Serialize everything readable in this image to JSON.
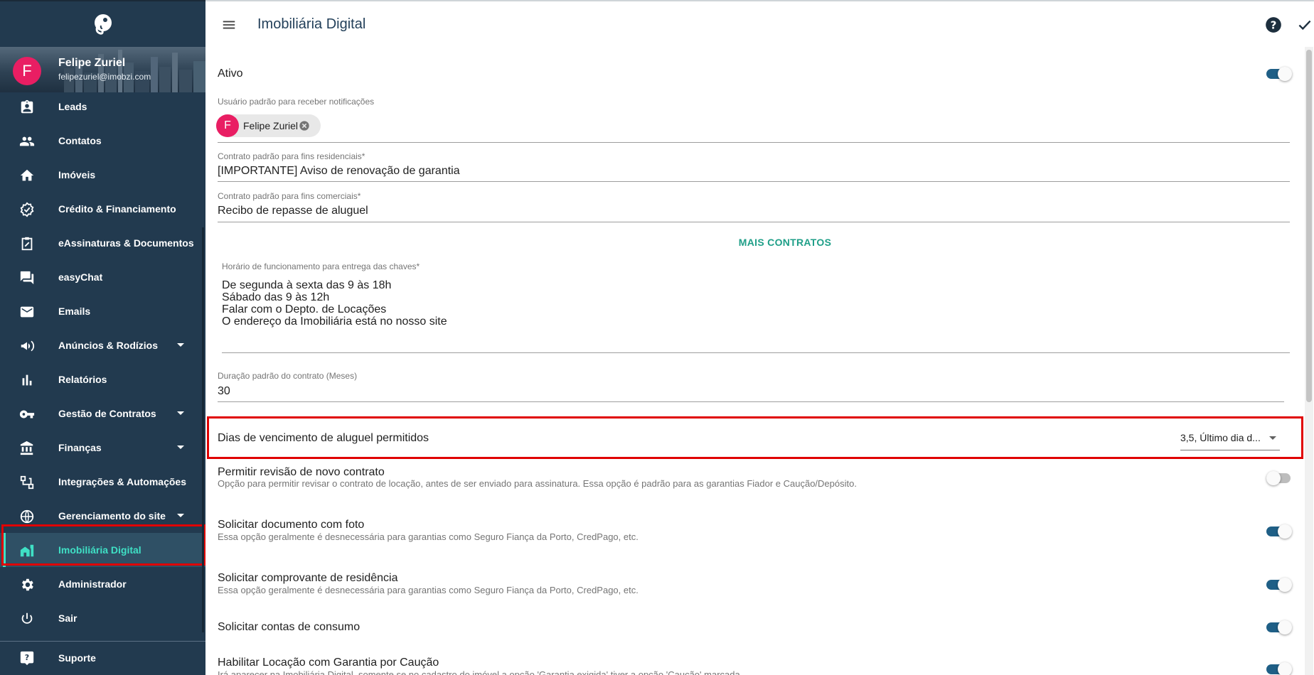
{
  "sidebar": {
    "user": {
      "initial": "F",
      "name": "Felipe Zuriel",
      "email": "felipezuriel@imobzi.com"
    },
    "items": [
      {
        "label": "Leads"
      },
      {
        "label": "Contatos"
      },
      {
        "label": "Imóveis"
      },
      {
        "label": "Crédito & Financiamento"
      },
      {
        "label": "eAssinaturas & Documentos"
      },
      {
        "label": "easyChat"
      },
      {
        "label": "Emails"
      },
      {
        "label": "Anúncios & Rodízios"
      },
      {
        "label": "Relatórios"
      },
      {
        "label": "Gestão de Contratos"
      },
      {
        "label": "Finanças"
      },
      {
        "label": "Integrações & Automações"
      },
      {
        "label": "Gerenciamento do site"
      },
      {
        "label": "Imobiliária Digital"
      },
      {
        "label": "Administrador"
      },
      {
        "label": "Sair"
      }
    ],
    "support_label": "Suporte"
  },
  "header": {
    "title": "Imobiliária Digital"
  },
  "form": {
    "ativo_label": "Ativo",
    "notify_user_label": "Usuário padrão para receber notificações",
    "notify_user_chip": {
      "initial": "F",
      "name": "Felipe Zuriel"
    },
    "residential_label": "Contrato padrão para fins residenciais*",
    "residential_value": "[IMPORTANTE] Aviso de renovação de garantia",
    "commercial_label": "Contrato padrão para fins comerciais*",
    "commercial_value": "Recibo de repasse de aluguel",
    "more_contracts": "MAIS CONTRATOS",
    "hours_label": "Horário de funcionamento para entrega das chaves*",
    "hours_lines": [
      "De segunda à sexta das 9 às 18h",
      "Sábado das 9 às 12h",
      "Falar com o Depto. de Locações",
      "O endereço da Imobiliária está no nosso site"
    ],
    "duration_label": "Duração padrão do contrato (Meses)",
    "duration_value": "30",
    "due_days_label": "Dias de vencimento de aluguel permitidos",
    "due_days_value": "3,5, Último dia d...",
    "options": [
      {
        "title": "Permitir revisão de novo contrato",
        "desc": "Opção para permitir revisar o contrato de locação, antes de ser enviado para assinatura. Essa opção é padrão para as garantias Fiador e Caução/Depósito.",
        "on": false
      },
      {
        "title": "Solicitar documento com foto",
        "desc": "Essa opção geralmente é desnecessária para garantias como Seguro Fiança da Porto, CredPago, etc.",
        "on": true
      },
      {
        "title": "Solicitar comprovante de residência",
        "desc": "Essa opção geralmente é desnecessária para garantias como Seguro Fiança da Porto, CredPago, etc.",
        "on": true
      },
      {
        "title": "Solicitar contas de consumo",
        "desc": "",
        "on": true
      },
      {
        "title": "Habilitar Locação com Garantia por Caução",
        "desc": "Irá aparecer na Imobiliária Digital, somente se no cadastro do imóvel a opção 'Garantia exigida' tiver a opção 'Caução' marcada.",
        "on": true
      }
    ]
  },
  "colors": {
    "sidebar_bg": "#223a4f",
    "accent": "#3fe0c5",
    "toggle_on": "#1f5f86",
    "highlight": "#e00000",
    "avatar": "#e91e63"
  }
}
